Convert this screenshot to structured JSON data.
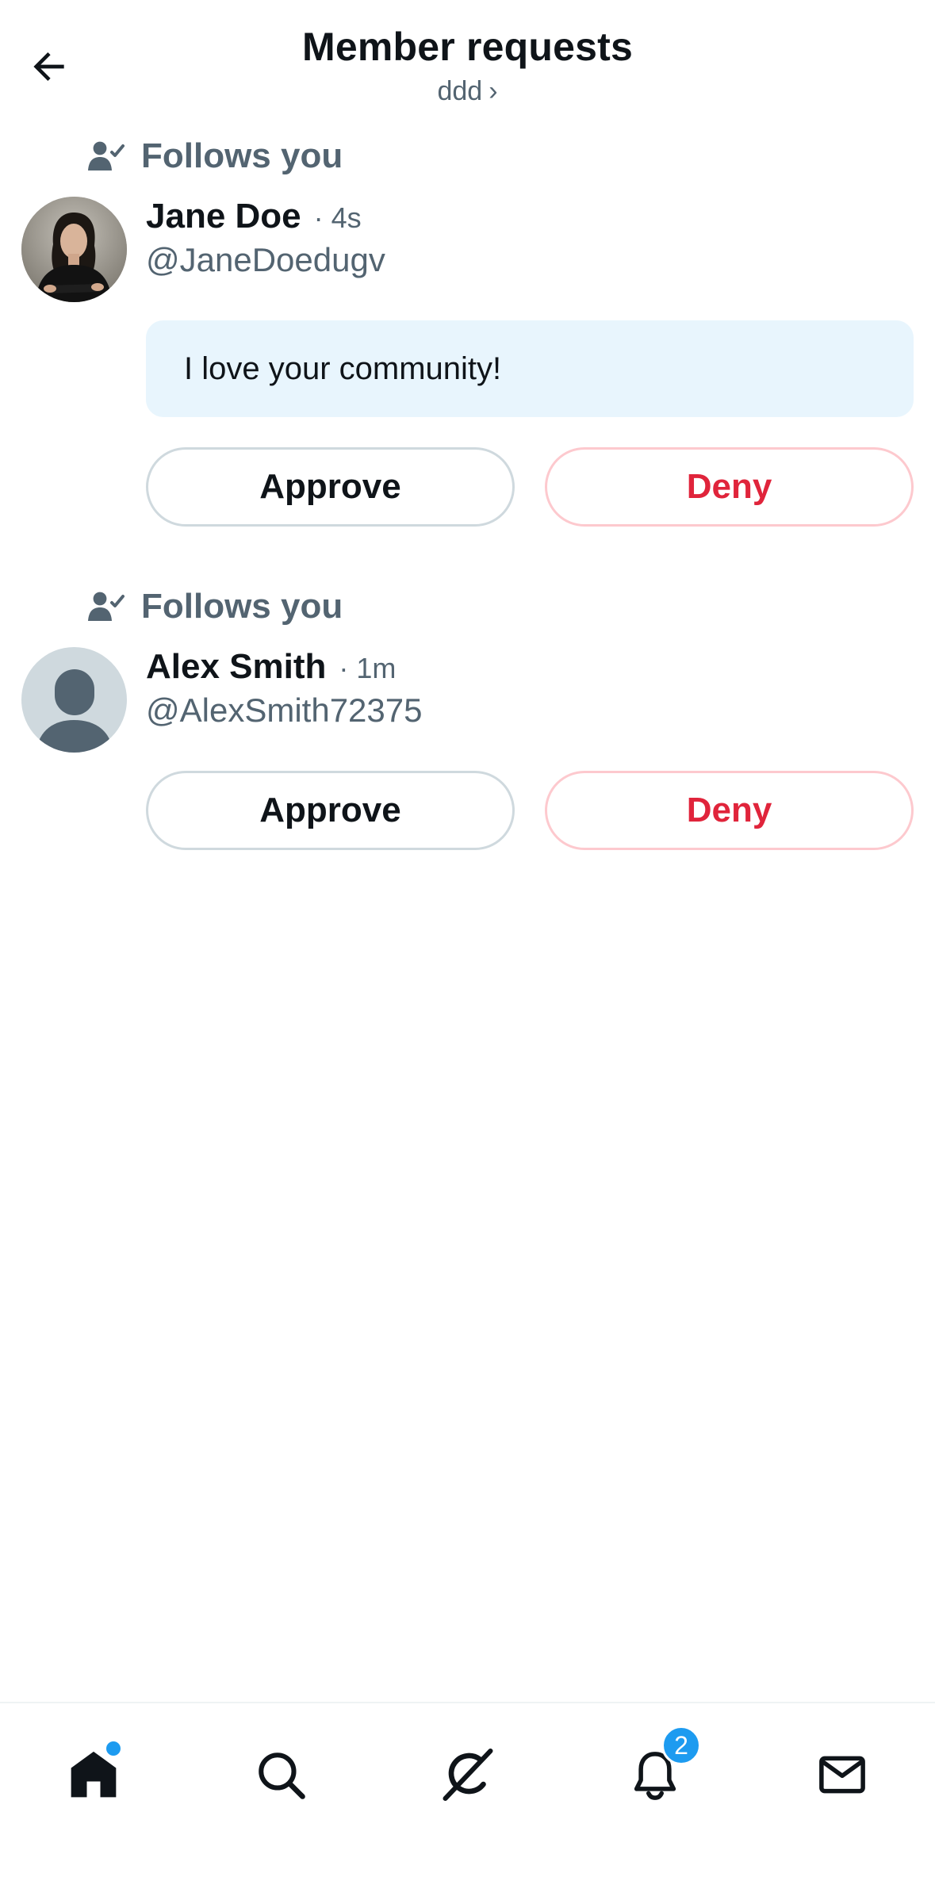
{
  "header": {
    "title": "Member requests",
    "community": "ddd",
    "community_chevron": "›",
    "back_icon": "arrow-left-icon"
  },
  "requests": [
    {
      "follows_label": "Follows you",
      "name": "Jane Doe",
      "time": "· 4s",
      "handle": "@JaneDoedugv",
      "message": "I love your community!",
      "approve_label": "Approve",
      "deny_label": "Deny"
    },
    {
      "follows_label": "Follows you",
      "name": "Alex Smith",
      "time": "· 1m",
      "handle": "@AlexSmith72375",
      "approve_label": "Approve",
      "deny_label": "Deny"
    }
  ],
  "bottom_nav": {
    "items": [
      {
        "name": "home",
        "icon": "home-icon",
        "has_dot": true
      },
      {
        "name": "search",
        "icon": "search-icon"
      },
      {
        "name": "grok",
        "icon": "grok-icon"
      },
      {
        "name": "notifications",
        "icon": "bell-icon",
        "badge": "2"
      },
      {
        "name": "messages",
        "icon": "mail-icon"
      }
    ]
  },
  "colors": {
    "accent": "#1d9bf0",
    "deny": "#e0243b",
    "secondary_text": "#536471",
    "message_bg": "#e8f5fd"
  }
}
